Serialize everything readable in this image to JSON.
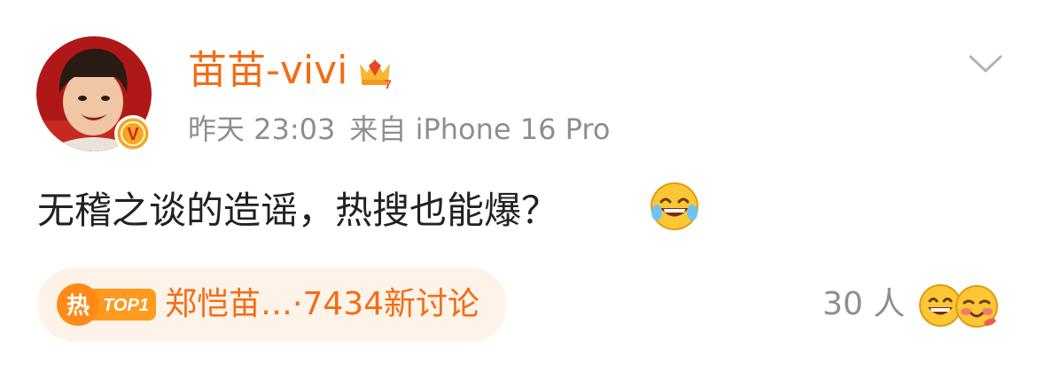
{
  "post": {
    "author_name": "苗苗-vivi",
    "time": "昨天 23:03",
    "source": "来自 iPhone 16 Pro",
    "text": "无稽之谈的造谣，热搜也能爆？",
    "verified_badge": "V",
    "member_badge_level": "7",
    "avatar_description_icon": "avatar-photo",
    "more_icon": "chevron-down-icon"
  },
  "hot_search": {
    "badge_label": "热",
    "rank_label": "TOP1",
    "text": "郑恺苗…·7434新讨论"
  },
  "reactions": {
    "count_label": "30 人",
    "emojis": [
      "laugh-icon",
      "grin-icon",
      "blush-icon"
    ]
  },
  "colors": {
    "accent": "#f56c14",
    "meta": "#8e8e8e",
    "text": "#222222",
    "pill_bg": "#fdf3e8",
    "avatar_bg": "#b01818",
    "emoji_yellow": "#fcc735"
  }
}
